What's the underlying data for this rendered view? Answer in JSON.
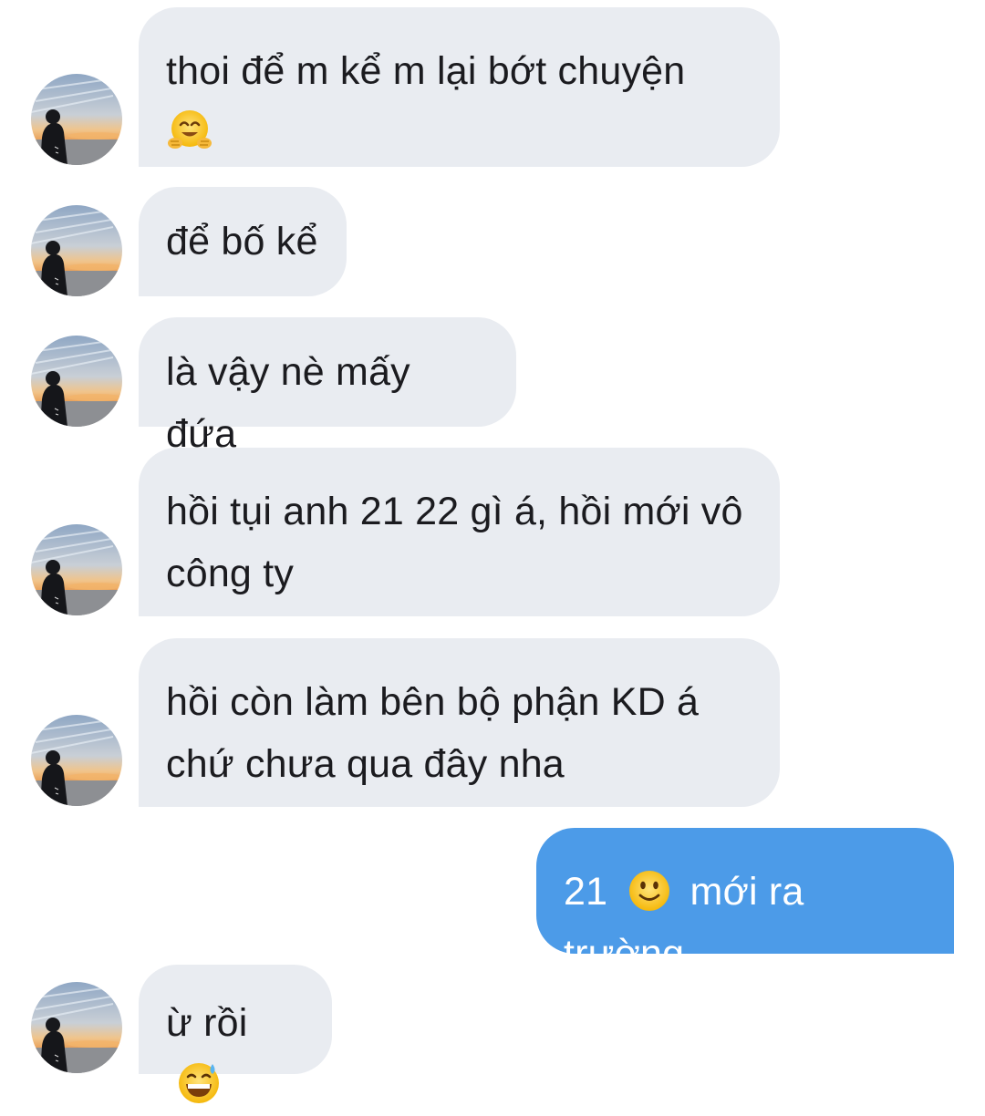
{
  "messages": [
    {
      "side": "in",
      "text": "thoi để m kể m lại bớt chuyện",
      "emoji": "hugging-face"
    },
    {
      "side": "in",
      "text": "để bố kể"
    },
    {
      "side": "in",
      "text": "là vậy nè mấy đứa"
    },
    {
      "side": "in",
      "line1": "hồi tụi anh 21 22 gì á, hồi mới vô",
      "line2": "công ty"
    },
    {
      "side": "in",
      "line1": "hồi còn làm bên bộ phận KD á",
      "line2": "chứ chưa qua đây nha"
    },
    {
      "side": "out",
      "text_before": "21",
      "emoji": "slightly-smiling-face",
      "text_after": "mới ra trường"
    },
    {
      "side": "in",
      "text": "ừ rồi",
      "emoji": "grinning-sweat-face"
    }
  ],
  "colors": {
    "incoming_bubble": "#e9ecf1",
    "outgoing_bubble": "#4c9be8",
    "incoming_text": "#1b1b1f",
    "outgoing_text": "#ffffff",
    "background": "#ffffff"
  },
  "avatar": {
    "icon": "avatar-sunset-photo"
  }
}
